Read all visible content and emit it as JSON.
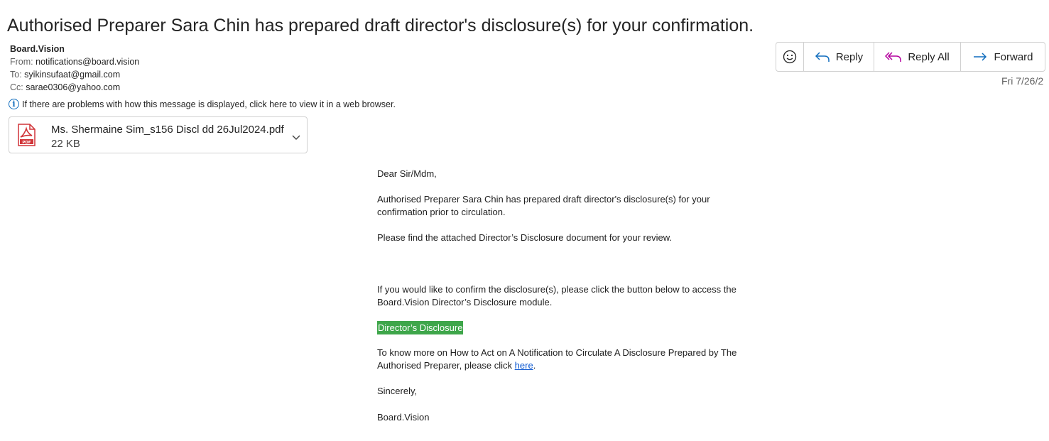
{
  "email": {
    "subject": "Authorised Preparer Sara Chin has prepared draft director's disclosure(s) for your confirmation.",
    "sender_name": "Board.Vision",
    "from_label": "From:",
    "from_value": "notifications@board.vision",
    "to_label": "To:",
    "to_value": "syikinsufaat@gmail.com",
    "cc_label": "Cc:",
    "cc_value": "sarae0306@yahoo.com",
    "info_text": "If there are problems with how this message is displayed, click here to view it in a web browser.",
    "date": "Fri 7/26/2"
  },
  "attachment": {
    "name": "Ms. Shermaine Sim_s156 Discl dd 26Jul2024.pdf",
    "size": "22 KB",
    "icon": "pdf-file-icon",
    "icon_label": "PDF"
  },
  "actions": {
    "emoji_icon": "smiley-icon",
    "reply": "Reply",
    "reply_all": "Reply All",
    "forward": "Forward"
  },
  "body": {
    "greeting": "Dear Sir/Mdm,",
    "para1": "Authorised Preparer Sara Chin has prepared draft director's disclosure(s) for your confirmation prior to circulation.",
    "para2": "Please find the attached Director’s Disclosure document for your review.",
    "para3": "If you would like to confirm the disclosure(s), please click the button below to access the Board.Vision Director’s Disclosure module.",
    "cta_label": "Director’s Disclosure",
    "para4_prefix": "To know more on How to Act on A Notification to Circulate A Disclosure Prepared by The Authorised Preparer, please click ",
    "para4_link": "here",
    "para4_suffix": ".",
    "closing": "Sincerely,",
    "signature": "Board.Vision"
  },
  "colors": {
    "cta_bg": "#3ea64a",
    "link": "#0b57d0",
    "accent": "#0f6cbd",
    "reply_icon": "#0f6cbd",
    "reply_all_icon": "#b4009e",
    "pdf_red": "#d13438"
  }
}
